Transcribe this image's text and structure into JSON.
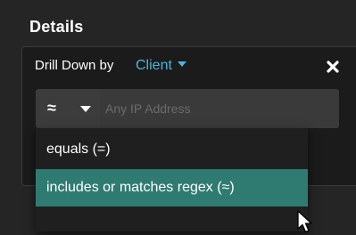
{
  "panel": {
    "title": "Details"
  },
  "drill_down": {
    "label": "Drill Down by",
    "value": "Client"
  },
  "filter": {
    "operator_symbol": "≈",
    "input_placeholder": "Any IP Address",
    "input_value": ""
  },
  "dropdown": {
    "options": [
      {
        "label": "equals (=)",
        "selected": false
      },
      {
        "label": "includes or matches regex (≈)",
        "selected": true
      }
    ]
  },
  "icons": {
    "close": "close-icon",
    "drill_caret": "chevron-down-icon",
    "operator_caret": "chevron-down-icon",
    "cursor": "mouse-pointer-icon"
  },
  "colors": {
    "accent": "#4fb3d9",
    "selected_background": "#2f7b72",
    "panel_background": "#252525",
    "card_background": "#1b1b1b"
  }
}
